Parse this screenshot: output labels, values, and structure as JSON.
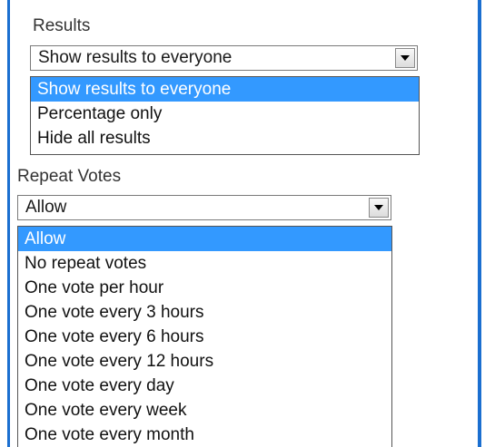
{
  "results": {
    "label": "Results",
    "selected_value": "Show results to everyone",
    "options": [
      "Show results to everyone",
      "Percentage only",
      "Hide all results"
    ],
    "highlighted_index": 0
  },
  "repeat_votes": {
    "label": "Repeat Votes",
    "selected_value": "Allow",
    "options": [
      "Allow",
      "No repeat votes",
      "One vote per hour",
      "One vote every 3 hours",
      "One vote every 6 hours",
      "One vote every 12 hours",
      "One vote every day",
      "One vote every week",
      "One vote every month"
    ],
    "highlighted_index": 0
  },
  "colors": {
    "highlight": "#3399ff",
    "accent_rule": "#1b6fd0"
  }
}
